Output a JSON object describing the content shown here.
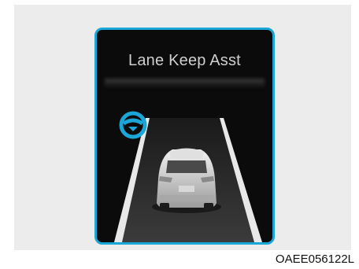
{
  "display": {
    "title": "Lane Keep Asst",
    "indicator_icon": "steering-wheel-icon",
    "accent_color": "#1aa6d6"
  },
  "image_code": "OAEE056122L"
}
